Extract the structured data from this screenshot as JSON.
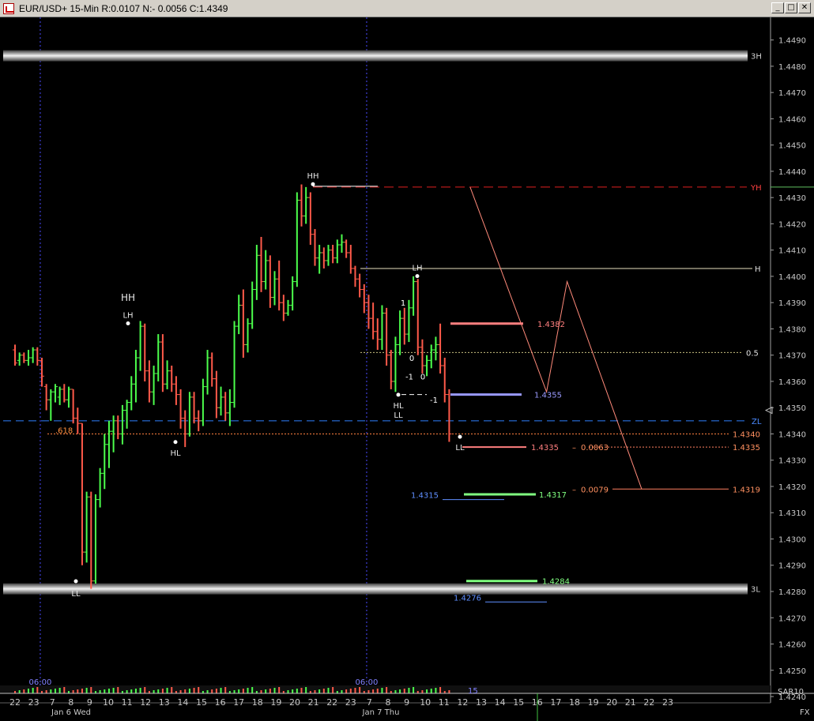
{
  "window": {
    "title": "EUR/USD+ 15-Min R:0.0107 N:- 0.0056 C:1.4349",
    "min_label": "_",
    "max_label": "□",
    "close_label": "✕"
  },
  "chart_data": {
    "type": "ohlc",
    "title": "EUR/USD+ 15-Min R:0.0107 N:- 0.0056 C:1.4349",
    "ylim": [
      1.4237,
      1.4495
    ],
    "y_ticks": [
      "1.4490",
      "1.4480",
      "1.4470",
      "1.4460",
      "1.4450",
      "1.4440",
      "1.4430",
      "1.4420",
      "1.4410",
      "1.4400",
      "1.4390",
      "1.4380",
      "1.4370",
      "1.4360",
      "1.4350",
      "1.4340",
      "1.4330",
      "1.4320",
      "1.4310",
      "1.4300",
      "1.4290",
      "1.4280",
      "1.4270",
      "1.4260",
      "1.4250",
      "1.4240"
    ],
    "x_ticks": [
      "22",
      "23",
      "7",
      "8",
      "9",
      "10",
      "11",
      "12",
      "13",
      "14",
      "15",
      "16",
      "17",
      "18",
      "19",
      "20",
      "21",
      "22",
      "23",
      "7",
      "8",
      "9",
      "10",
      "11",
      "12",
      "13",
      "14",
      "15",
      "16",
      "17",
      "18",
      "19",
      "20",
      "21",
      "22",
      "23"
    ],
    "x_tick_index": [
      0,
      1,
      2,
      3,
      4,
      5,
      6,
      7,
      8,
      9,
      10,
      11,
      12,
      13,
      14,
      15,
      16,
      17,
      18,
      19,
      20,
      21,
      22,
      23,
      24,
      25,
      26,
      27,
      28,
      29,
      30,
      31,
      32,
      33,
      34,
      35
    ],
    "date_labels": [
      "Jan 6 Wed",
      "Jan 7 Thu"
    ],
    "session_labels": [
      "06:00",
      "06:00"
    ],
    "session_index": [
      1.1,
      18.6
    ],
    "indicator_label": "SAR10",
    "indicator_value": "15",
    "fx_label": "FX",
    "bars": [
      {
        "i": 0.0,
        "o": 1.4372,
        "h": 1.4374,
        "l": 1.4366,
        "c": 1.4367
      },
      {
        "i": 0.24,
        "o": 1.4368,
        "h": 1.4371,
        "l": 1.4366,
        "c": 1.437
      },
      {
        "i": 0.48,
        "o": 1.437,
        "h": 1.4371,
        "l": 1.4367,
        "c": 1.4368
      },
      {
        "i": 0.72,
        "o": 1.4368,
        "h": 1.4372,
        "l": 1.4366,
        "c": 1.4369
      },
      {
        "i": 0.96,
        "o": 1.4369,
        "h": 1.4373,
        "l": 1.4367,
        "c": 1.4372
      },
      {
        "i": 1.2,
        "o": 1.4372,
        "h": 1.4373,
        "l": 1.4366,
        "c": 1.4368
      },
      {
        "i": 1.44,
        "o": 1.4368,
        "h": 1.4369,
        "l": 1.4358,
        "c": 1.4362
      },
      {
        "i": 1.68,
        "o": 1.4358,
        "h": 1.4359,
        "l": 1.4349,
        "c": 1.4353
      },
      {
        "i": 1.92,
        "o": 1.4353,
        "h": 1.4357,
        "l": 1.4345,
        "c": 1.4356
      },
      {
        "i": 2.16,
        "o": 1.4356,
        "h": 1.4359,
        "l": 1.4352,
        "c": 1.4358
      },
      {
        "i": 2.4,
        "o": 1.4354,
        "h": 1.4358,
        "l": 1.4351,
        "c": 1.4357
      },
      {
        "i": 2.64,
        "o": 1.4357,
        "h": 1.4359,
        "l": 1.4352,
        "c": 1.4353
      },
      {
        "i": 2.88,
        "o": 1.4353,
        "h": 1.4358,
        "l": 1.435,
        "c": 1.4357
      },
      {
        "i": 3.12,
        "o": 1.4357,
        "h": 1.4357,
        "l": 1.4344,
        "c": 1.4346
      },
      {
        "i": 3.36,
        "o": 1.4346,
        "h": 1.435,
        "l": 1.434,
        "c": 1.4344
      },
      {
        "i": 3.6,
        "o": 1.4344,
        "h": 1.4344,
        "l": 1.429,
        "c": 1.4295
      },
      {
        "i": 3.84,
        "o": 1.4295,
        "h": 1.4318,
        "l": 1.4291,
        "c": 1.4316
      },
      {
        "i": 4.08,
        "o": 1.4316,
        "h": 1.4318,
        "l": 1.4281,
        "c": 1.4284
      },
      {
        "i": 4.32,
        "o": 1.4284,
        "h": 1.4317,
        "l": 1.4283,
        "c": 1.4315
      },
      {
        "i": 4.56,
        "o": 1.4315,
        "h": 1.4327,
        "l": 1.4312,
        "c": 1.4325
      },
      {
        "i": 4.8,
        "o": 1.4325,
        "h": 1.434,
        "l": 1.4319,
        "c": 1.4336
      },
      {
        "i": 5.04,
        "o": 1.4336,
        "h": 1.4345,
        "l": 1.4327,
        "c": 1.4341
      },
      {
        "i": 5.28,
        "o": 1.4341,
        "h": 1.4347,
        "l": 1.4333,
        "c": 1.4345
      },
      {
        "i": 5.52,
        "o": 1.4345,
        "h": 1.4347,
        "l": 1.4338,
        "c": 1.434
      },
      {
        "i": 5.76,
        "o": 1.434,
        "h": 1.4351,
        "l": 1.4336,
        "c": 1.4349
      },
      {
        "i": 6.0,
        "o": 1.4349,
        "h": 1.4353,
        "l": 1.4342,
        "c": 1.4352
      },
      {
        "i": 6.24,
        "o": 1.4352,
        "h": 1.4362,
        "l": 1.4349,
        "c": 1.4359
      },
      {
        "i": 6.48,
        "o": 1.4359,
        "h": 1.4372,
        "l": 1.4352,
        "c": 1.4369
      },
      {
        "i": 6.72,
        "o": 1.4369,
        "h": 1.4383,
        "l": 1.4364,
        "c": 1.4381
      },
      {
        "i": 6.96,
        "o": 1.4381,
        "h": 1.4382,
        "l": 1.436,
        "c": 1.4364
      },
      {
        "i": 7.2,
        "o": 1.4364,
        "h": 1.4368,
        "l": 1.4352,
        "c": 1.4356
      },
      {
        "i": 7.44,
        "o": 1.4356,
        "h": 1.4366,
        "l": 1.4351,
        "c": 1.4363
      },
      {
        "i": 7.68,
        "o": 1.4363,
        "h": 1.4378,
        "l": 1.436,
        "c": 1.4375
      },
      {
        "i": 7.92,
        "o": 1.4375,
        "h": 1.4378,
        "l": 1.4356,
        "c": 1.4359
      },
      {
        "i": 8.16,
        "o": 1.4359,
        "h": 1.4368,
        "l": 1.4357,
        "c": 1.4364
      },
      {
        "i": 8.4,
        "o": 1.4364,
        "h": 1.4366,
        "l": 1.4356,
        "c": 1.4359
      },
      {
        "i": 8.64,
        "o": 1.4359,
        "h": 1.4362,
        "l": 1.4351,
        "c": 1.4355
      },
      {
        "i": 8.88,
        "o": 1.4355,
        "h": 1.4357,
        "l": 1.4342,
        "c": 1.4346
      },
      {
        "i": 9.12,
        "o": 1.4346,
        "h": 1.4349,
        "l": 1.4335,
        "c": 1.434
      },
      {
        "i": 9.36,
        "o": 1.434,
        "h": 1.4356,
        "l": 1.4339,
        "c": 1.4354
      },
      {
        "i": 9.6,
        "o": 1.4354,
        "h": 1.4356,
        "l": 1.4344,
        "c": 1.4346
      },
      {
        "i": 9.84,
        "o": 1.4346,
        "h": 1.4349,
        "l": 1.4341,
        "c": 1.4345
      },
      {
        "i": 10.08,
        "o": 1.4345,
        "h": 1.4361,
        "l": 1.4343,
        "c": 1.4358
      },
      {
        "i": 10.32,
        "o": 1.4358,
        "h": 1.4372,
        "l": 1.4355,
        "c": 1.4369
      },
      {
        "i": 10.56,
        "o": 1.4369,
        "h": 1.4371,
        "l": 1.4358,
        "c": 1.4361
      },
      {
        "i": 10.8,
        "o": 1.4361,
        "h": 1.4364,
        "l": 1.4346,
        "c": 1.435
      },
      {
        "i": 11.04,
        "o": 1.435,
        "h": 1.4358,
        "l": 1.4347,
        "c": 1.4354
      },
      {
        "i": 11.28,
        "o": 1.4354,
        "h": 1.4356,
        "l": 1.4345,
        "c": 1.4348
      },
      {
        "i": 11.52,
        "o": 1.4348,
        "h": 1.4357,
        "l": 1.4343,
        "c": 1.4352
      },
      {
        "i": 11.76,
        "o": 1.4352,
        "h": 1.4383,
        "l": 1.435,
        "c": 1.4381
      },
      {
        "i": 12.0,
        "o": 1.4381,
        "h": 1.4393,
        "l": 1.4378,
        "c": 1.4389
      },
      {
        "i": 12.24,
        "o": 1.4389,
        "h": 1.4395,
        "l": 1.4369,
        "c": 1.4374
      },
      {
        "i": 12.48,
        "o": 1.4374,
        "h": 1.4384,
        "l": 1.4371,
        "c": 1.4382
      },
      {
        "i": 12.72,
        "o": 1.4382,
        "h": 1.4398,
        "l": 1.438,
        "c": 1.4395
      },
      {
        "i": 12.96,
        "o": 1.4395,
        "h": 1.4412,
        "l": 1.4391,
        "c": 1.4408
      },
      {
        "i": 13.2,
        "o": 1.4408,
        "h": 1.4415,
        "l": 1.4394,
        "c": 1.4398
      },
      {
        "i": 13.44,
        "o": 1.4398,
        "h": 1.441,
        "l": 1.4395,
        "c": 1.4406
      },
      {
        "i": 13.68,
        "o": 1.4406,
        "h": 1.4408,
        "l": 1.4388,
        "c": 1.4392
      },
      {
        "i": 13.92,
        "o": 1.4392,
        "h": 1.4402,
        "l": 1.4389,
        "c": 1.4399
      },
      {
        "i": 14.16,
        "o": 1.4399,
        "h": 1.4406,
        "l": 1.4387,
        "c": 1.439
      },
      {
        "i": 14.4,
        "o": 1.439,
        "h": 1.4393,
        "l": 1.4383,
        "c": 1.4386
      },
      {
        "i": 14.64,
        "o": 1.4386,
        "h": 1.4391,
        "l": 1.4385,
        "c": 1.4389
      },
      {
        "i": 14.88,
        "o": 1.4389,
        "h": 1.44,
        "l": 1.4387,
        "c": 1.4398
      },
      {
        "i": 15.12,
        "o": 1.4398,
        "h": 1.4432,
        "l": 1.4396,
        "c": 1.4429
      },
      {
        "i": 15.36,
        "o": 1.4429,
        "h": 1.4435,
        "l": 1.4419,
        "c": 1.4423
      },
      {
        "i": 15.6,
        "o": 1.4423,
        "h": 1.4434,
        "l": 1.442,
        "c": 1.443
      },
      {
        "i": 15.84,
        "o": 1.443,
        "h": 1.4432,
        "l": 1.4412,
        "c": 1.4416
      },
      {
        "i": 16.08,
        "o": 1.4416,
        "h": 1.4418,
        "l": 1.4404,
        "c": 1.4407
      },
      {
        "i": 16.32,
        "o": 1.4407,
        "h": 1.4412,
        "l": 1.4401,
        "c": 1.4409
      },
      {
        "i": 16.56,
        "o": 1.4409,
        "h": 1.4411,
        "l": 1.4403,
        "c": 1.4406
      },
      {
        "i": 16.8,
        "o": 1.4406,
        "h": 1.4412,
        "l": 1.4404,
        "c": 1.441
      },
      {
        "i": 17.04,
        "o": 1.441,
        "h": 1.4412,
        "l": 1.4405,
        "c": 1.4407
      },
      {
        "i": 17.28,
        "o": 1.4407,
        "h": 1.4414,
        "l": 1.4405,
        "c": 1.4412
      },
      {
        "i": 17.52,
        "o": 1.4412,
        "h": 1.4416,
        "l": 1.4409,
        "c": 1.4413
      },
      {
        "i": 17.76,
        "o": 1.4413,
        "h": 1.4414,
        "l": 1.4407,
        "c": 1.4409
      },
      {
        "i": 18.0,
        "o": 1.4409,
        "h": 1.4412,
        "l": 1.4401,
        "c": 1.4403
      },
      {
        "i": 18.24,
        "o": 1.4403,
        "h": 1.4404,
        "l": 1.4396,
        "c": 1.4399
      },
      {
        "i": 18.48,
        "o": 1.4399,
        "h": 1.4401,
        "l": 1.4392,
        "c": 1.4395
      },
      {
        "i": 18.72,
        "o": 1.4395,
        "h": 1.4397,
        "l": 1.4386,
        "c": 1.439
      },
      {
        "i": 18.96,
        "o": 1.439,
        "h": 1.4393,
        "l": 1.438,
        "c": 1.4384
      },
      {
        "i": 19.2,
        "o": 1.4384,
        "h": 1.439,
        "l": 1.4376,
        "c": 1.4379
      },
      {
        "i": 19.44,
        "o": 1.4379,
        "h": 1.4384,
        "l": 1.4372,
        "c": 1.4376
      },
      {
        "i": 19.68,
        "o": 1.4376,
        "h": 1.4389,
        "l": 1.4372,
        "c": 1.4386
      },
      {
        "i": 19.92,
        "o": 1.4386,
        "h": 1.4388,
        "l": 1.4366,
        "c": 1.437
      },
      {
        "i": 20.16,
        "o": 1.437,
        "h": 1.4372,
        "l": 1.4357,
        "c": 1.436
      },
      {
        "i": 20.4,
        "o": 1.436,
        "h": 1.4377,
        "l": 1.4356,
        "c": 1.4374
      },
      {
        "i": 20.64,
        "o": 1.4374,
        "h": 1.4387,
        "l": 1.437,
        "c": 1.4384
      },
      {
        "i": 20.88,
        "o": 1.4384,
        "h": 1.4388,
        "l": 1.4374,
        "c": 1.4378
      },
      {
        "i": 21.12,
        "o": 1.4378,
        "h": 1.4391,
        "l": 1.4375,
        "c": 1.4388
      },
      {
        "i": 21.36,
        "o": 1.4388,
        "h": 1.44,
        "l": 1.4385,
        "c": 1.4398
      },
      {
        "i": 21.6,
        "o": 1.4398,
        "h": 1.4399,
        "l": 1.437,
        "c": 1.4373
      },
      {
        "i": 21.84,
        "o": 1.4373,
        "h": 1.4376,
        "l": 1.4363,
        "c": 1.4366
      },
      {
        "i": 22.08,
        "o": 1.4366,
        "h": 1.437,
        "l": 1.4362,
        "c": 1.4368
      },
      {
        "i": 22.32,
        "o": 1.4368,
        "h": 1.4374,
        "l": 1.4365,
        "c": 1.4372
      },
      {
        "i": 22.56,
        "o": 1.4372,
        "h": 1.4377,
        "l": 1.4368,
        "c": 1.4374
      },
      {
        "i": 22.8,
        "o": 1.4374,
        "h": 1.4382,
        "l": 1.4363,
        "c": 1.4366
      },
      {
        "i": 23.04,
        "o": 1.4366,
        "h": 1.4369,
        "l": 1.4352,
        "c": 1.4355
      },
      {
        "i": 23.28,
        "o": 1.4355,
        "h": 1.4357,
        "l": 1.4337,
        "c": 1.434
      }
    ],
    "horizontal_levels": [
      {
        "label": "3H",
        "value": 1.4484,
        "style": "band"
      },
      {
        "label": "YH",
        "value": 1.4434,
        "style": "dashed-red"
      },
      {
        "label": "H",
        "value": 1.4403,
        "style": "solid-thin"
      },
      {
        "label": "0.5",
        "value": 1.4371,
        "style": "dotted"
      },
      {
        "label": "ZL",
        "value": 1.4345,
        "style": "dashed-blue"
      },
      {
        "label": "3L",
        "value": 1.4281,
        "style": "band"
      }
    ],
    "price_labels": [
      {
        "text": "1.4382",
        "value": 1.4382,
        "color": "#ff7f7f"
      },
      {
        "text": "1.4355",
        "value": 1.4355,
        "color": "#9a9aff"
      },
      {
        "text": "1.4335",
        "value": 1.4335,
        "color": "#ff7f7f"
      },
      {
        "text": "1.4317",
        "value": 1.4317,
        "color": "#80ff80"
      },
      {
        "text": "1.4315",
        "value": 1.4315,
        "color": "#5f8fff"
      },
      {
        "text": "1.4284",
        "value": 1.4284,
        "color": "#80ff80"
      },
      {
        "text": "1.4276",
        "value": 1.4276,
        "color": "#5f8fff"
      }
    ],
    "fib_label": ".618",
    "fib_value": 1.434,
    "right_values": [
      "1.4340",
      "1.4335",
      "1.4319"
    ],
    "diffs": [
      "0.0063",
      "0.0079"
    ],
    "swing_labels": [
      "HH",
      "HH",
      "LH",
      "HL",
      "LL",
      "LH",
      "HL",
      "LL",
      "LL"
    ],
    "wave_labels": [
      "1",
      "0",
      "-1",
      "0",
      "-1"
    ],
    "projection_path": [
      {
        "i": 24.4,
        "v": 1.4434
      },
      {
        "i": 28.5,
        "v": 1.4356
      },
      {
        "i": 29.6,
        "v": 1.4398
      },
      {
        "i": 33.6,
        "v": 1.4319
      }
    ],
    "volume_index_cut": 24.0,
    "colors": {
      "up": "#4cff4c",
      "down": "#ff5a4a",
      "grid_session": "#4a4aff",
      "yh_line": "#e02020",
      "zl_line": "#2f7fff",
      "projection": "#ff8a7a",
      "axis_text": "#c8c8c8",
      "background": "#000000"
    }
  }
}
